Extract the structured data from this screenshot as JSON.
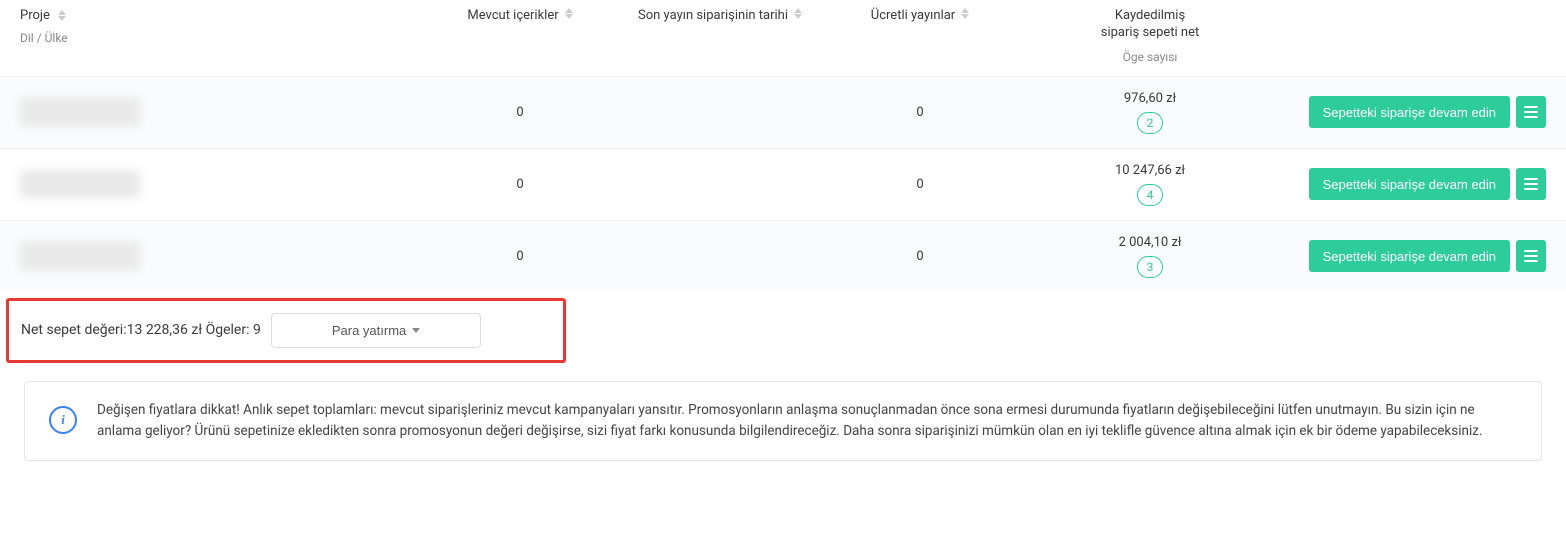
{
  "columns": {
    "proje": "Proje",
    "proje_sub": "Dil / Ülke",
    "mevcut": "Mevcut içerikler",
    "son": "Son yayın siparişinin tarihi",
    "ucretli": "Ücretli yayınlar",
    "kayd_line1": "Kaydedilmiş",
    "kayd_line2": "sipariş sepeti net",
    "kayd_sub": "Öge sayısı"
  },
  "rows": [
    {
      "mevcut": "0",
      "son": "",
      "ucretli": "0",
      "price": "976,60 zł",
      "count": "2"
    },
    {
      "mevcut": "0",
      "son": "",
      "ucretli": "0",
      "price": "10 247,66 zł",
      "count": "4"
    },
    {
      "mevcut": "0",
      "son": "",
      "ucretli": "0",
      "price": "2 004,10 zł",
      "count": "3"
    }
  ],
  "actions": {
    "continue": "Sepetteki siparişe devam edin"
  },
  "summary": {
    "net_label": "Net sepet değeri:",
    "net_value": "13 228,36 zł",
    "items_label": "Ögeler:",
    "items_value": "9",
    "deposit": "Para yatırma"
  },
  "alert": {
    "text": "Değişen fiyatlara dikkat! Anlık sepet toplamları: mevcut siparişleriniz mevcut kampanyaları yansıtır. Promosyonların anlaşma sonuçlanmadan önce sona ermesi durumunda fiyatların değişebileceğini lütfen unutmayın. Bu sizin için ne anlama geliyor? Ürünü sepetinize ekledikten sonra promosyonun değeri değişirse, sizi fiyat farkı konusunda bilgilendireceğiz. Daha sonra siparişinizi mümkün olan en iyi teklifle güvence altına almak için ek bir ödeme yapabileceksiniz."
  }
}
